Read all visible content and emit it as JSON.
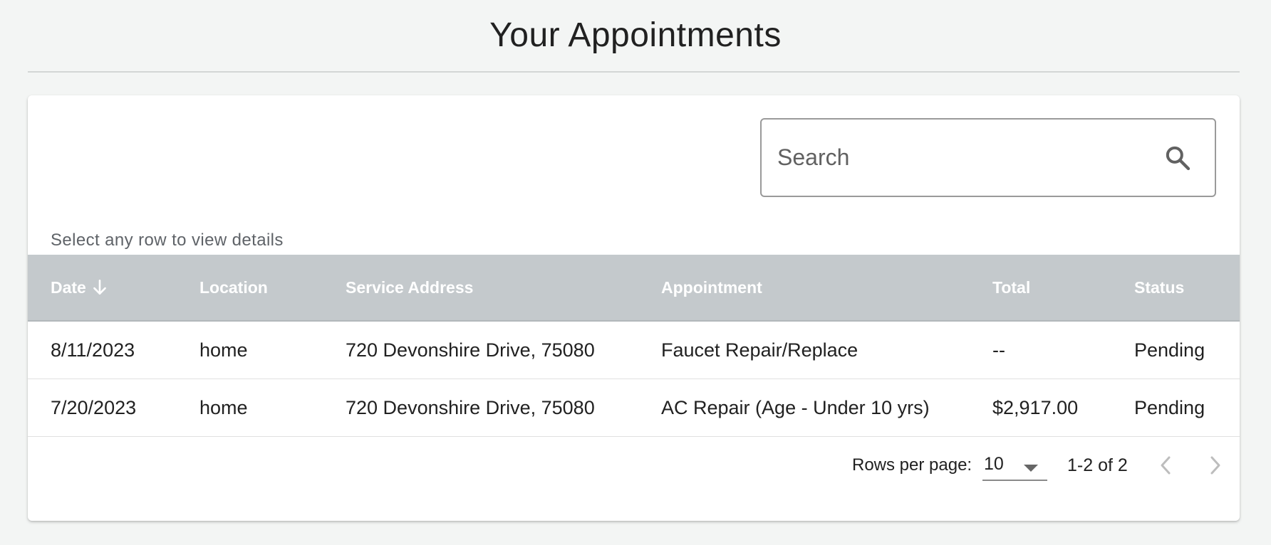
{
  "page": {
    "title": "Your Appointments"
  },
  "search": {
    "placeholder": "Search",
    "value": ""
  },
  "helper_text": "Select any row to view details",
  "table": {
    "columns": [
      "Date",
      "Location",
      "Service Address",
      "Appointment",
      "Total",
      "Status"
    ],
    "sort": {
      "column": "Date",
      "direction": "descending"
    },
    "rows": [
      {
        "date": "8/11/2023",
        "location": "home",
        "address": "720 Devonshire Drive, 75080",
        "appointment": "Faucet Repair/Replace",
        "total": "--",
        "status": "Pending"
      },
      {
        "date": "7/20/2023",
        "location": "home",
        "address": "720 Devonshire Drive, 75080",
        "appointment": "AC Repair (Age - Under 10 yrs)",
        "total": "$2,917.00",
        "status": "Pending"
      }
    ]
  },
  "pagination": {
    "rows_per_page_label": "Rows per page:",
    "rows_per_page_value": "10",
    "range_text": "1-2 of 2"
  },
  "icons": {
    "search": "search-icon",
    "sort": "arrow-down-icon",
    "caret": "caret-down-icon",
    "prev": "chevron-left-icon",
    "next": "chevron-right-icon"
  },
  "colors": {
    "background": "#f3f5f4",
    "header_bg": "#c4c9cc",
    "header_text": "#ffffff",
    "card_bg": "#ffffff"
  }
}
